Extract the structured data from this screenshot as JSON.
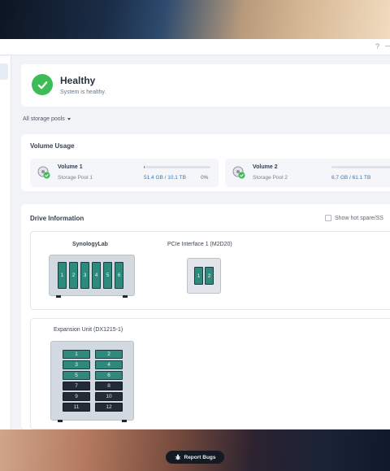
{
  "titlebar": {
    "help_icon": "?",
    "minimize_icon": "—"
  },
  "health": {
    "title": "Healthy",
    "subtitle": "System is healthy."
  },
  "filter": {
    "label": "All storage pools"
  },
  "volume_usage": {
    "title": "Volume Usage",
    "volumes": [
      {
        "name": "Volume 1",
        "pool": "Storage Pool 1",
        "used": "51.4 GB / 10.1 TB",
        "percent": "0%",
        "fill_fraction": 0.005
      },
      {
        "name": "Volume 2",
        "pool": "Storage Pool 2",
        "used": "6.7 GB / 61.1 TB",
        "fill_fraction": 0.001
      }
    ]
  },
  "drive_info": {
    "title": "Drive Information",
    "hot_spare_label": "Show hot spare/SS",
    "devices": [
      {
        "name": "SynologyLab",
        "bays": [
          "1",
          "2",
          "3",
          "4",
          "5",
          "6"
        ]
      },
      {
        "name": "PCIe Interface 1 (M2D20)",
        "bays": [
          "1",
          "2"
        ]
      },
      {
        "name": "Expansion Unit (DX1215-1)",
        "bays": [
          "1",
          "2",
          "3",
          "4",
          "5",
          "6",
          "7",
          "8",
          "9",
          "10",
          "11",
          "12"
        ],
        "used_bays": 6
      }
    ]
  },
  "report_bugs": {
    "label": "Report Bugs"
  },
  "colors": {
    "healthy": "#3dbb57",
    "accent": "#1e7cd6",
    "bay_used": "#2f8a7e",
    "bay_empty": "#232b36"
  }
}
